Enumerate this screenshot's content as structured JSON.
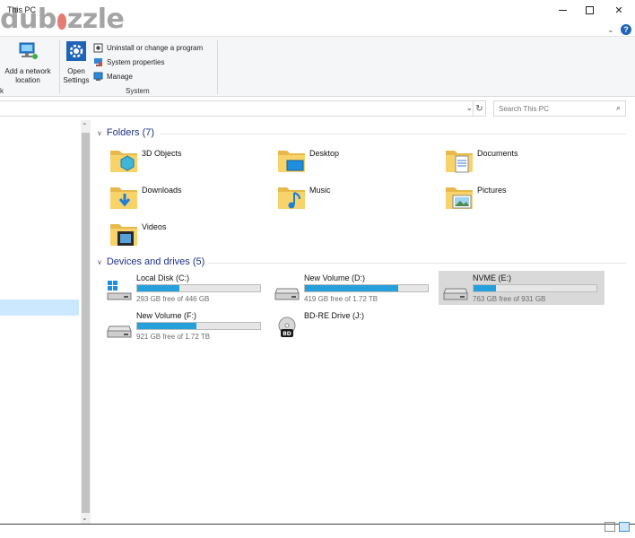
{
  "window": {
    "title": "This PC",
    "watermark": "dubizzle"
  },
  "ribbon": {
    "add_network_location_line1": "Add a network",
    "add_network_location_line2": "location",
    "open_settings_line1": "Open",
    "open_settings_line2": "Settings",
    "uninstall": "Uninstall or change a program",
    "system_properties": "System properties",
    "manage": "Manage",
    "group_left_label": "k",
    "group_system_label": "System",
    "help": "?"
  },
  "address": {
    "search_placeholder": "Search This PC"
  },
  "folders": {
    "heading": "Folders (7)",
    "items": [
      {
        "label": "3D Objects",
        "icon": "3d-objects-folder-icon"
      },
      {
        "label": "Desktop",
        "icon": "desktop-folder-icon"
      },
      {
        "label": "Documents",
        "icon": "documents-folder-icon"
      },
      {
        "label": "Downloads",
        "icon": "downloads-folder-icon"
      },
      {
        "label": "Music",
        "icon": "music-folder-icon"
      },
      {
        "label": "Pictures",
        "icon": "pictures-folder-icon"
      },
      {
        "label": "Videos",
        "icon": "videos-folder-icon"
      }
    ]
  },
  "drives": {
    "heading": "Devices and drives (5)",
    "items": [
      {
        "name": "Local Disk (C:)",
        "free": "293 GB free of 446 GB",
        "used_fraction": 0.34,
        "icon": "windows-drive-icon"
      },
      {
        "name": "New Volume (D:)",
        "free": "419 GB free of 1.72 TB",
        "used_fraction": 0.76,
        "icon": "hard-drive-icon"
      },
      {
        "name": "NVME (E:)",
        "free": "763 GB free of 931 GB",
        "used_fraction": 0.18,
        "icon": "hard-drive-icon"
      },
      {
        "name": "New Volume (F:)",
        "free": "921 GB free of 1.72 TB",
        "used_fraction": 0.48,
        "icon": "hard-drive-icon"
      },
      {
        "name": "BD-RE Drive (J:)",
        "free": "",
        "icon": "bluray-drive-icon",
        "disc_label": "BD"
      }
    ]
  },
  "colors": {
    "accent": "#26a0da",
    "heading": "#1e3287",
    "selection": "#cce8ff"
  }
}
